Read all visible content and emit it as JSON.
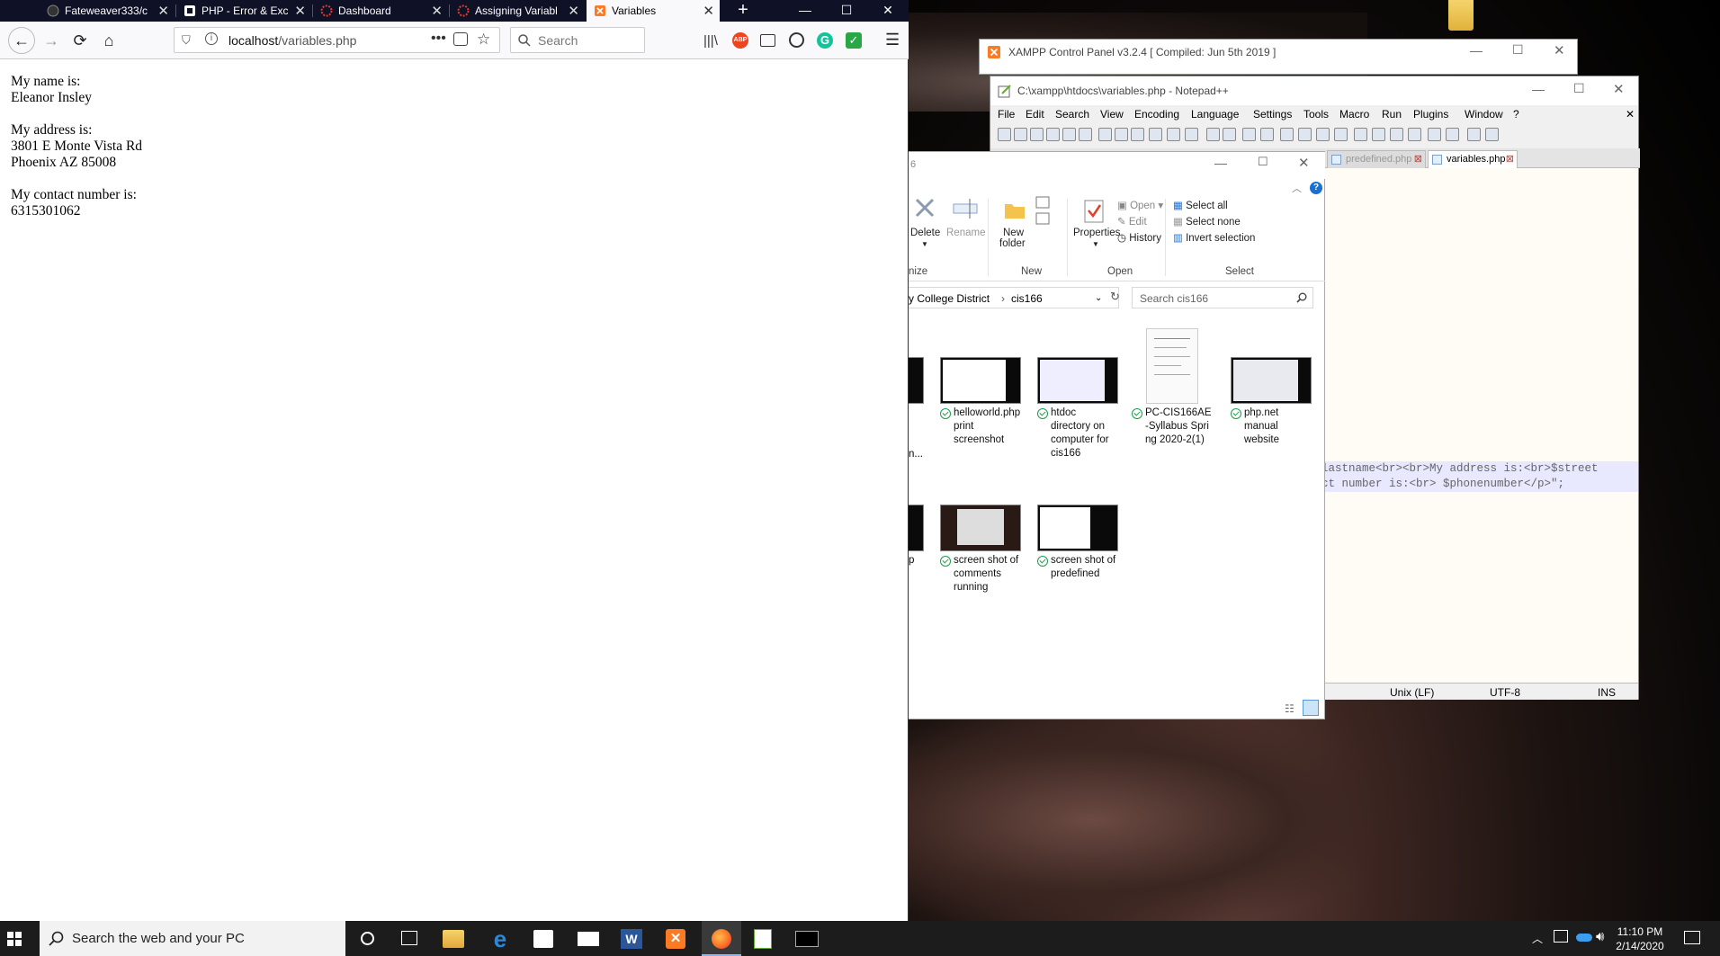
{
  "firefox": {
    "tabs": [
      {
        "label": "Fateweaver333/c",
        "icon": "github-icon"
      },
      {
        "label": "PHP - Error & Exc",
        "icon": "php-icon"
      },
      {
        "label": "Dashboard",
        "icon": "canvas-icon"
      },
      {
        "label": "Assigning Variabl",
        "icon": "canvas-icon"
      },
      {
        "label": "Variables",
        "icon": "xampp-icon",
        "active": true
      }
    ],
    "url_host": "localhost",
    "url_path": "/variables.php",
    "search_placeholder": "Search",
    "content": {
      "name_label": "My name is:",
      "name_value": "Eleanor Insley",
      "address_label": "My address is:",
      "address_line1": "3801 E Monte Vista Rd",
      "address_line2": "Phoenix AZ 85008",
      "contact_label": "My contact number is:",
      "contact_value": "6315301062"
    }
  },
  "xampp": {
    "title": "XAMPP Control Panel v3.2.4   [ Compiled: Jun 5th 2019 ]"
  },
  "notepad": {
    "title": "C:\\xampp\\htdocs\\variables.php - Notepad++",
    "menu": [
      "File",
      "Edit",
      "Search",
      "View",
      "Encoding",
      "Language",
      "Settings",
      "Tools",
      "Macro",
      "Run",
      "Plugins",
      "Window",
      "?"
    ],
    "tabs": [
      {
        "label": "predefined.php",
        "active": false
      },
      {
        "label": "variables.php",
        "active": true
      }
    ],
    "code_line1": "lastname<br><br>My address is:<br>$street",
    "code_line2": "ct number is:<br> $phonenumber</p>\";",
    "status": {
      "eol": "Unix (LF)",
      "encoding": "UTF-8",
      "mode": "INS"
    }
  },
  "explorer": {
    "ribbon": {
      "delete": "Delete",
      "rename": "Rename",
      "new_folder_1": "New",
      "new_folder_2": "folder",
      "properties": "Properties",
      "open": "Open",
      "edit": "Edit",
      "history": "History",
      "select_all": "Select all",
      "select_none": "Select none",
      "invert_selection": "Invert selection",
      "group_organize": "nize",
      "group_new": "New",
      "group_open": "Open",
      "group_select": "Select"
    },
    "path": [
      "y College District",
      "cis166"
    ],
    "search_placeholder": "Search cis166",
    "files": [
      {
        "name": "helloworld.php print screenshot"
      },
      {
        "name": "htdoc directory on computer for cis166"
      },
      {
        "name": "PC-CIS166AE-Syllabus Spring 2020-2(1)"
      },
      {
        "name": "php.net manual website"
      },
      {
        "name": "screen shot of comments running"
      },
      {
        "name": "screen shot of predefined"
      }
    ],
    "partial_labels": {
      "row1": "n...",
      "row2": "p"
    }
  },
  "taskbar": {
    "search_placeholder": "Search the web and your PC",
    "time": "11:10 PM",
    "date": "2/14/2020"
  },
  "colors": {
    "firefox_tabbar": "#0f1126",
    "taskbar": "#1c1c1c",
    "accent": "#0078d7",
    "editor_bg": "#fffcf5"
  }
}
